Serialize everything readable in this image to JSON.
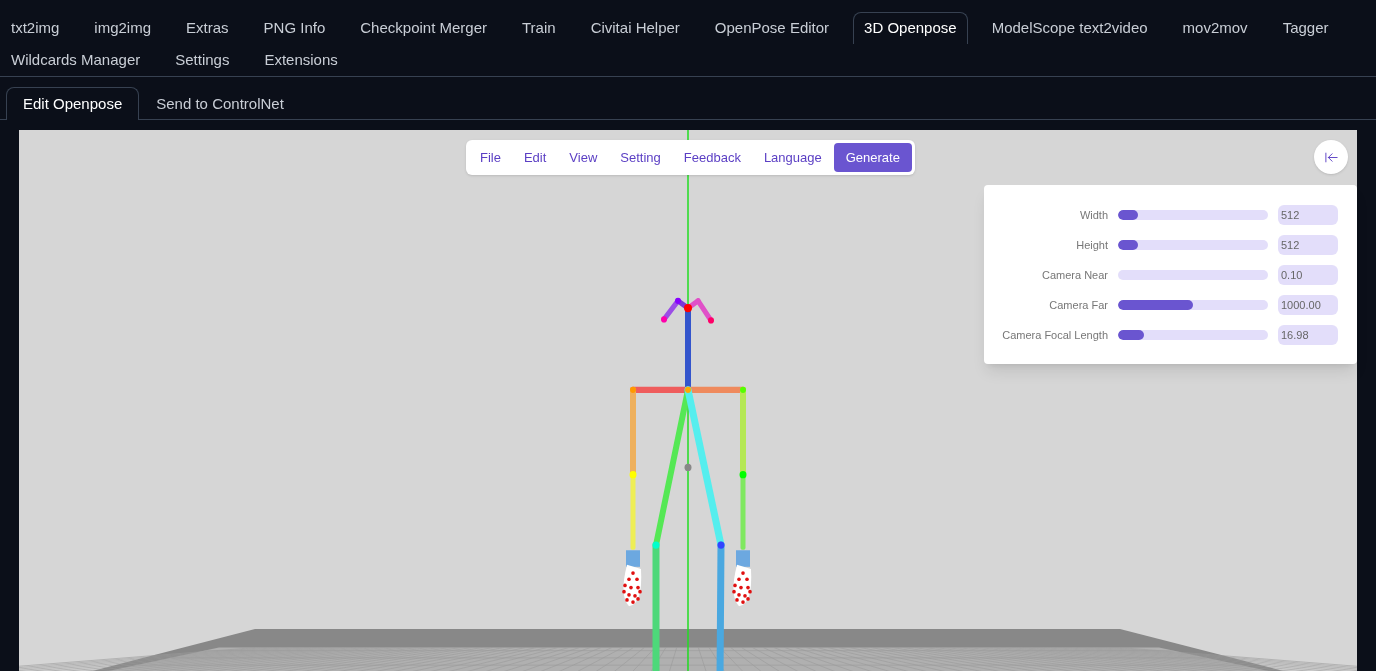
{
  "main_tabs": [
    {
      "label": "txt2img",
      "selected": false
    },
    {
      "label": "img2img",
      "selected": false
    },
    {
      "label": "Extras",
      "selected": false
    },
    {
      "label": "PNG Info",
      "selected": false
    },
    {
      "label": "Checkpoint Merger",
      "selected": false
    },
    {
      "label": "Train",
      "selected": false
    },
    {
      "label": "Civitai Helper",
      "selected": false
    },
    {
      "label": "OpenPose Editor",
      "selected": false
    },
    {
      "label": "3D Openpose",
      "selected": true
    },
    {
      "label": "ModelScope text2video",
      "selected": false
    },
    {
      "label": "mov2mov",
      "selected": false
    },
    {
      "label": "Tagger",
      "selected": false
    },
    {
      "label": "Wildcards Manager",
      "selected": false
    },
    {
      "label": "Settings",
      "selected": false
    },
    {
      "label": "Extensions",
      "selected": false
    }
  ],
  "sub_tabs": [
    {
      "label": "Edit Openpose",
      "selected": true
    },
    {
      "label": "Send to ControlNet",
      "selected": false
    }
  ],
  "menu": {
    "items": [
      "File",
      "Edit",
      "View",
      "Setting",
      "Feedback",
      "Language"
    ],
    "action": "Generate"
  },
  "settings_panel": {
    "rows": [
      {
        "label": "Width",
        "level": 0.13,
        "value": "512"
      },
      {
        "label": "Height",
        "level": 0.13,
        "value": "512"
      },
      {
        "label": "Camera Near",
        "level": 0,
        "value": "0.10"
      },
      {
        "label": "Camera Far",
        "level": 0.5,
        "value": "1000.00"
      },
      {
        "label": "Camera Focal Length",
        "level": 0.17,
        "value": "16.98"
      }
    ]
  }
}
